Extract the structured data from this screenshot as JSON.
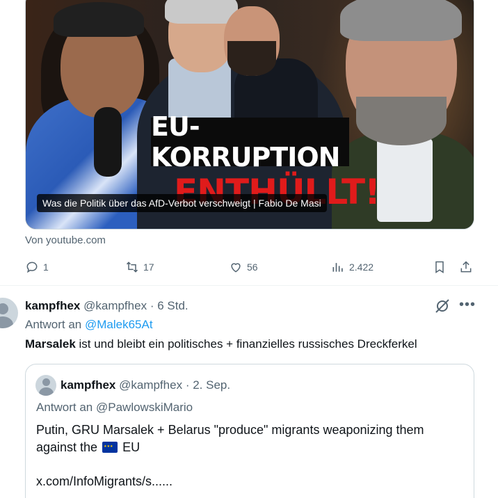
{
  "link_card": {
    "thumbnail_headline": "EU-KORRUPTION",
    "thumbnail_headline2": "ENTHÜLLT!",
    "caption": "Was die Politik über das AfD-Verbot verschweigt | Fabio De Masi",
    "source": "Von youtube.com"
  },
  "actions": {
    "replies": "1",
    "reposts": "17",
    "likes": "56",
    "views": "2.422",
    "icons": [
      "reply-icon",
      "repost-icon",
      "like-icon",
      "views-icon",
      "bookmark-icon",
      "share-icon"
    ]
  },
  "tweet": {
    "name": "kampfhex",
    "handle": "@kampfhex",
    "time": "6 Std.",
    "reply_prefix": "Antwort an",
    "reply_to": "@Malek65At",
    "text_bold": "Marsalek",
    "text_rest": " ist und bleibt ein politisches + finanzielles russisches Dreckferkel",
    "quote": {
      "name": "kampfhex",
      "handle": "@kampfhex",
      "time": "2. Sep.",
      "reply_line": "Antwort an @PawlowskiMario",
      "text_line1": "Putin, GRU Marsalek + Belarus \"produce\" migrants weaponizing them",
      "text_line2_prefix": "against the",
      "text_line2_suffix": "EU",
      "link": "x.com/InfoMigrants/s......"
    }
  },
  "colors": {
    "text": "#0f1419",
    "muted": "#536471",
    "link": "#1d9bf0",
    "border": "#cfd9de",
    "headline_red": "#e01b1b"
  }
}
